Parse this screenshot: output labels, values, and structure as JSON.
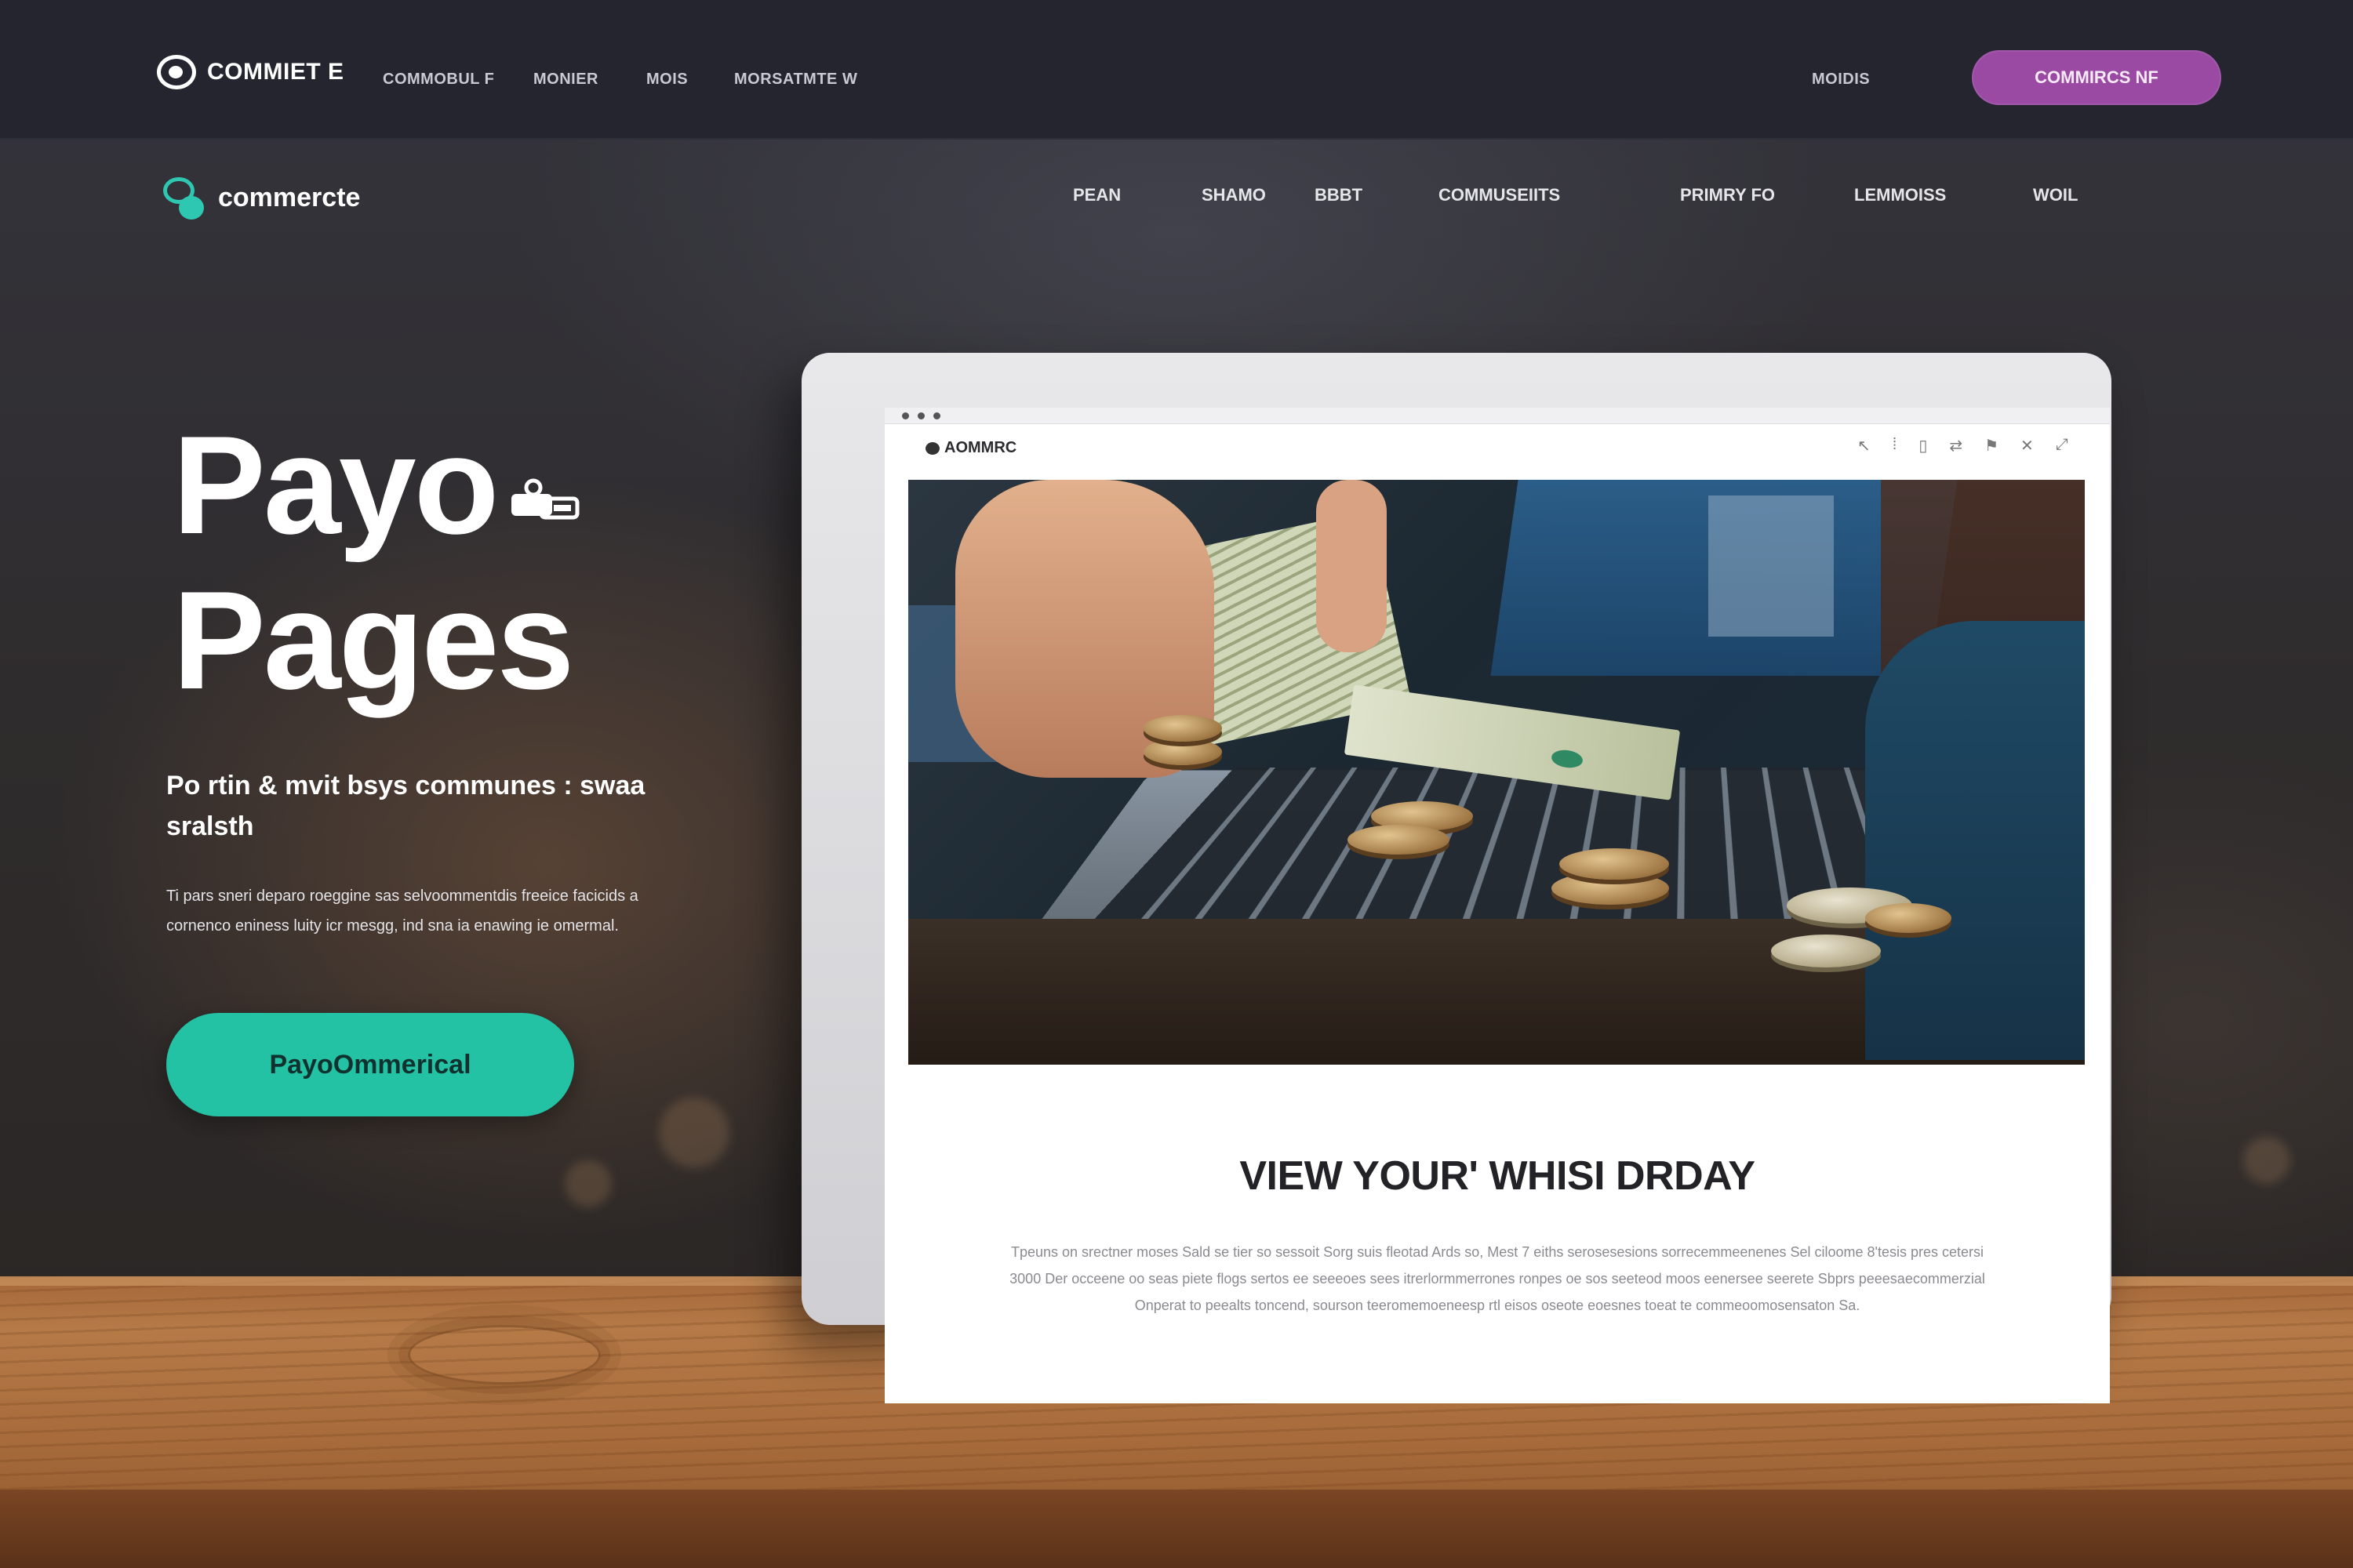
{
  "colors": {
    "topbar_bg": "#24252f",
    "accent_purple": "#9b4aa3",
    "accent_teal": "#23c2a5",
    "logo_teal": "#2ec7b1"
  },
  "topbar": {
    "logo_text": "COMMIET E",
    "logo_icon": "eye-logo-icon",
    "links": [
      "COMMOBUL F",
      "MONIER",
      "MOIS",
      "MORSATMTE W"
    ],
    "right_link": "MOIDIS",
    "cta_label": "COMMIRCS NF"
  },
  "subnav": {
    "logo_text": "commercte",
    "logo_icon": "teal-logo-icon",
    "links": [
      "PEAN",
      "SHAMO",
      "BBBT",
      "COMMUSEIITS",
      "PRIMRY FO",
      "LEMMOISS",
      "WOIL"
    ]
  },
  "hero": {
    "title_line1": "Payo",
    "title_line2": "Pages",
    "deco_icon": "card-wallet-icon",
    "subtitle": "Po rtin & mvit bsys communes : swaa sralsth",
    "description": "Ti pars sneri deparo roeggine sas selvoommentdis freeice facicids a cornenco eniness luity icr mesgg, ind sna ia enawing ie omermal.",
    "cta_label": "PayoOmmerical"
  },
  "device": {
    "brand": "AOMMRC",
    "toolbar_icons": [
      "arrow-icon",
      "pin-icon",
      "bookmark-icon",
      "share-icon",
      "flag-icon",
      "close-icon",
      "expand-icon"
    ],
    "heading": "VIEW YOUR' WHISI DRDAY",
    "paragraph": "Tpeuns on srectner moses Sald se tier so sessoit Sorg suis fleotad Ards so, Mest 7 eiths serosesesions sorrecemmeenenes Sel ciloome 8'tesis pres cetersi 3000 Der occeene oo seas piete flogs sertos ee seeeoes sees itrerlormmerrones ronpes oe sos seeteod moos eenersee seerete Sbprs peeesaecommerzial Onperat to peealts toncend, sourson teeromemoeneesp rtl eisos oseote eoesnes toeat te commeoomosensaton Sa."
  }
}
